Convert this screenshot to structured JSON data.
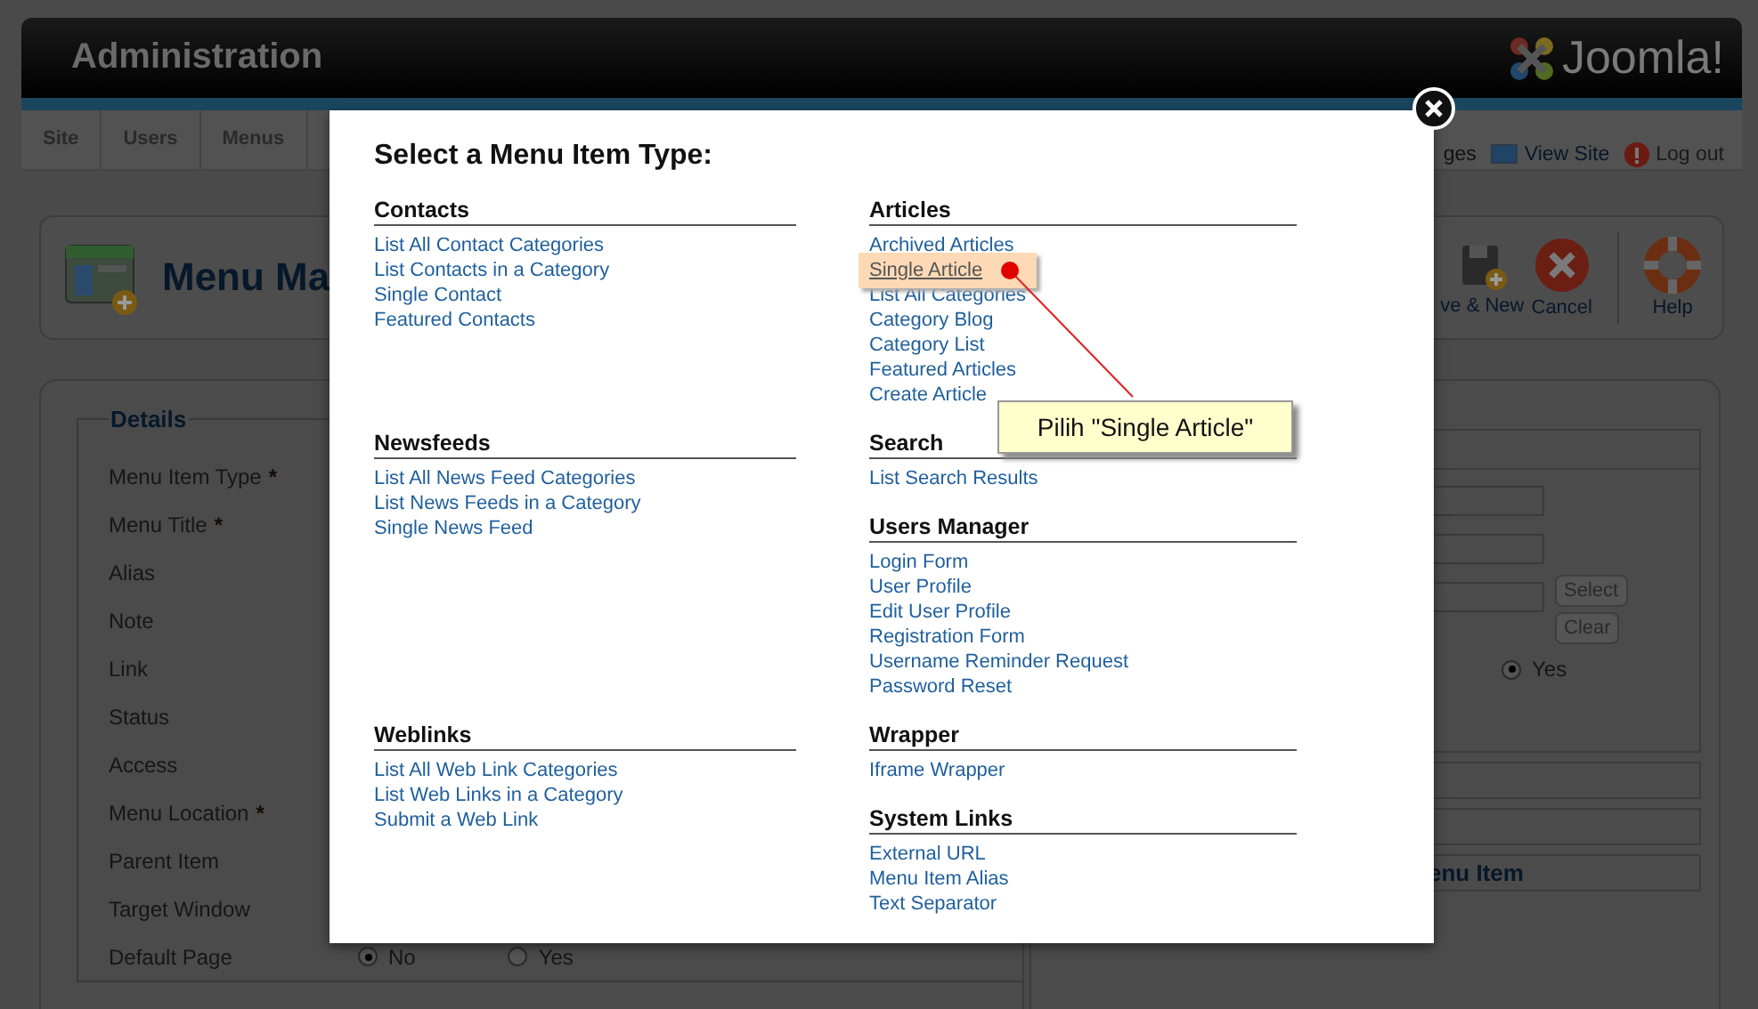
{
  "header": {
    "title": "Administration",
    "logo": "Joomla!"
  },
  "menu_bar": {
    "items": [
      "Site",
      "Users",
      "Menus"
    ],
    "links": [
      {
        "label": "ges",
        "kind": "plain"
      },
      {
        "label": "View Site",
        "kind": "site"
      },
      {
        "label": "Log out",
        "kind": "logout"
      }
    ]
  },
  "toolbar": {
    "title": "Menu Ma",
    "buttons": [
      {
        "label": "ve & New",
        "kind": "save-new"
      },
      {
        "label": "Cancel",
        "kind": "cancel"
      },
      {
        "label": "Help",
        "kind": "help"
      }
    ]
  },
  "details": {
    "legend": "Details",
    "fields": [
      {
        "label": "Menu Item Type",
        "required_mark": "*"
      },
      {
        "label": "Menu Title",
        "required_mark": "*"
      },
      {
        "label": "Alias"
      },
      {
        "label": "Note"
      },
      {
        "label": "Link"
      },
      {
        "label": "Status"
      },
      {
        "label": "Access"
      },
      {
        "label": "Menu Location",
        "required_mark": "*"
      },
      {
        "label": "Parent Item"
      },
      {
        "label": "Target Window"
      },
      {
        "label": "Default Page"
      }
    ],
    "default_page_options": [
      {
        "label": "No",
        "selected": true
      },
      {
        "label": "Yes",
        "selected": false
      }
    ]
  },
  "side_panel": {
    "buttons": [
      "Select",
      "Clear"
    ],
    "radio": {
      "label": "Yes",
      "selected": true
    },
    "heading": "enu Item"
  },
  "modal": {
    "title": "Select a Menu Item Type:",
    "rows": [
      {
        "left": [
          {
            "title": "Contacts",
            "items": [
              {
                "label": "List All Contact Categories",
                "selected": false
              },
              {
                "label": "List Contacts in a Category",
                "selected": false
              },
              {
                "label": "Single Contact",
                "selected": false
              },
              {
                "label": "Featured Contacts",
                "selected": false
              }
            ]
          }
        ],
        "right": [
          {
            "title": "Articles",
            "items": [
              {
                "label": "Archived Articles",
                "selected": false
              },
              {
                "label": "Single Article",
                "selected": true
              },
              {
                "label": "List All Categories",
                "selected": false
              },
              {
                "label": "Category Blog",
                "selected": false
              },
              {
                "label": "Category List",
                "selected": false
              },
              {
                "label": "Featured Articles",
                "selected": false
              },
              {
                "label": "Create Article",
                "selected": false
              }
            ]
          }
        ]
      },
      {
        "left": [
          {
            "title": "Newsfeeds",
            "items": [
              {
                "label": "List All News Feed Categories",
                "selected": false
              },
              {
                "label": "List News Feeds in a Category",
                "selected": false
              },
              {
                "label": "Single News Feed",
                "selected": false
              }
            ]
          }
        ],
        "right": [
          {
            "title": "Search",
            "items": [
              {
                "label": "List Search Results",
                "selected": false
              }
            ]
          },
          {
            "title": "Users Manager",
            "items": [
              {
                "label": "Login Form",
                "selected": false
              },
              {
                "label": "User Profile",
                "selected": false
              },
              {
                "label": "Edit User Profile",
                "selected": false
              },
              {
                "label": "Registration Form",
                "selected": false
              },
              {
                "label": "Username Reminder Request",
                "selected": false
              },
              {
                "label": "Password Reset",
                "selected": false
              }
            ]
          }
        ]
      },
      {
        "left": [
          {
            "title": "Weblinks",
            "items": [
              {
                "label": "List All Web Link Categories",
                "selected": false
              },
              {
                "label": "List Web Links in a Category",
                "selected": false
              },
              {
                "label": "Submit a Web Link",
                "selected": false
              }
            ]
          }
        ],
        "right": [
          {
            "title": "Wrapper",
            "items": [
              {
                "label": "Iframe Wrapper",
                "selected": false
              }
            ]
          },
          {
            "title": "System Links",
            "items": [
              {
                "label": "External URL",
                "selected": false
              },
              {
                "label": "Menu Item Alias",
                "selected": false
              },
              {
                "label": "Text Separator",
                "selected": false
              }
            ]
          }
        ]
      }
    ]
  },
  "callout": {
    "text": "Pilih \"Single Article\""
  }
}
